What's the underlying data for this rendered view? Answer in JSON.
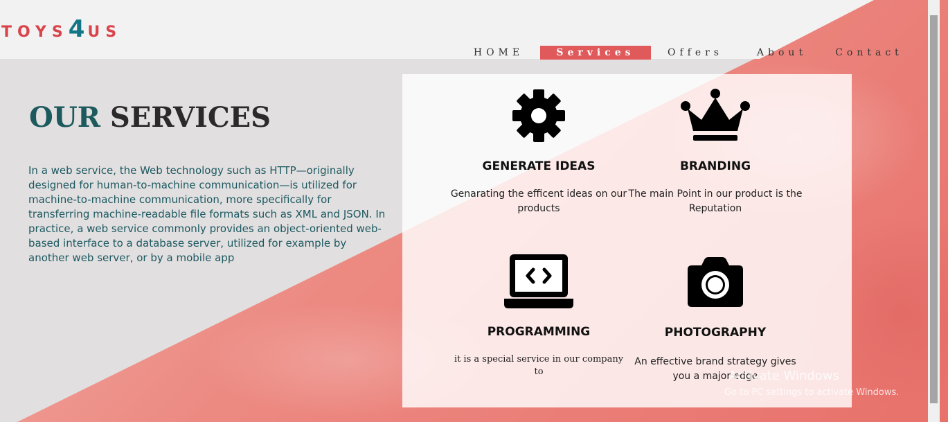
{
  "brand": {
    "pre": "TOYS",
    "four": "4",
    "post": "US"
  },
  "nav": [
    "HOME",
    "Services",
    "Offers",
    "About",
    "Contact"
  ],
  "hero": {
    "title_a": "OUR",
    "title_b": "SERVICES",
    "description": "In a web service, the Web technology such as HTTP—originally designed for human-to-machine communication—is utilized for machine-to-machine communication, more specifically for transferring machine-readable file formats such as XML and JSON. In practice, a web service commonly provides an object-oriented web-based interface to a database server, utilized for example by another web server, or by a mobile app"
  },
  "services": [
    {
      "icon": "gear-icon",
      "title": "GENERATE IDEAS",
      "text": "Genarating the efficent ideas on our products"
    },
    {
      "icon": "crown-icon",
      "title": "BRANDING",
      "text": "The main Point in our product is the Reputation"
    },
    {
      "icon": "laptop-code-icon",
      "title": "PROGRAMMING",
      "text": "it is a special service in our company to"
    },
    {
      "icon": "camera-icon",
      "title": "PHOTOGRAPHY",
      "text": "An effective brand strategy gives you a major edge"
    }
  ],
  "watermark": {
    "line1": "Activate Windows",
    "line2": "Go to PC settings to activate Windows."
  },
  "colors": {
    "accent": "#e05a5c",
    "teal": "#1d5a5e",
    "logo_red": "#d9434a",
    "logo_teal": "#127686"
  }
}
